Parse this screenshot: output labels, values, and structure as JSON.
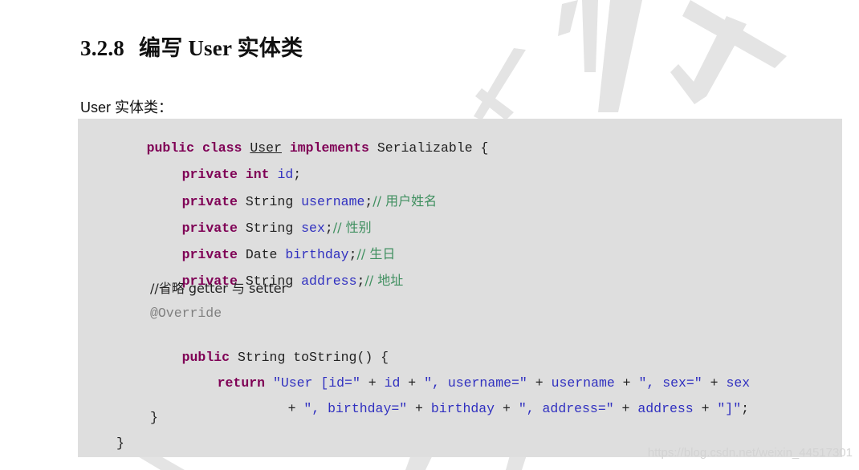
{
  "section": {
    "number": "3.2.8",
    "title": "编写 User 实体类"
  },
  "intro_text": "User 实体类：",
  "code": {
    "class_decl": {
      "kw1": "public",
      "kw2": "class",
      "name": "User",
      "kw3": "implements",
      "iface": "Serializable {"
    },
    "fields": [
      {
        "mod": "private",
        "type": "int",
        "name": "id",
        "suffix": ";",
        "comment": ""
      },
      {
        "mod": "private",
        "type": "String",
        "name": "username",
        "suffix": ";",
        "comment": "// 用户姓名"
      },
      {
        "mod": "private",
        "type": "String",
        "name": "sex",
        "suffix": ";",
        "comment": "// 性别"
      },
      {
        "mod": "private",
        "type": "Date",
        "name": "birthday",
        "suffix": ";",
        "comment": "// 生日"
      },
      {
        "mod": "private",
        "type": "String",
        "name": "address",
        "suffix": ";",
        "comment": "// 地址"
      }
    ],
    "omit_comment": "//省略 getter 与 setter",
    "annotation": "@Override",
    "method_decl": {
      "kw": "public",
      "rest": "String toString() {"
    },
    "return_kw": "return",
    "return_line1": [
      {
        "t": "\"User [id=\"",
        "c": "str"
      },
      {
        "t": " + ",
        "c": "plain"
      },
      {
        "t": "id",
        "c": "fld"
      },
      {
        "t": " + ",
        "c": "plain"
      },
      {
        "t": "\", username=\"",
        "c": "str"
      },
      {
        "t": " + ",
        "c": "plain"
      },
      {
        "t": "username",
        "c": "fld"
      },
      {
        "t": " + ",
        "c": "plain"
      },
      {
        "t": "\", sex=\"",
        "c": "str"
      },
      {
        "t": " + ",
        "c": "plain"
      },
      {
        "t": "sex",
        "c": "fld"
      }
    ],
    "return_line2": [
      {
        "t": "+ ",
        "c": "plain"
      },
      {
        "t": "\", birthday=\"",
        "c": "str"
      },
      {
        "t": " + ",
        "c": "plain"
      },
      {
        "t": "birthday",
        "c": "fld"
      },
      {
        "t": " + ",
        "c": "plain"
      },
      {
        "t": "\", address=\"",
        "c": "str"
      },
      {
        "t": " + ",
        "c": "plain"
      },
      {
        "t": "address",
        "c": "fld"
      },
      {
        "t": " + ",
        "c": "plain"
      },
      {
        "t": "\"]\"",
        "c": "str"
      },
      {
        "t": ";",
        "c": "plain"
      }
    ],
    "method_close": "}",
    "class_close": "}"
  },
  "watermark_url": "https://blog.csdn.net/weixin_44517301"
}
